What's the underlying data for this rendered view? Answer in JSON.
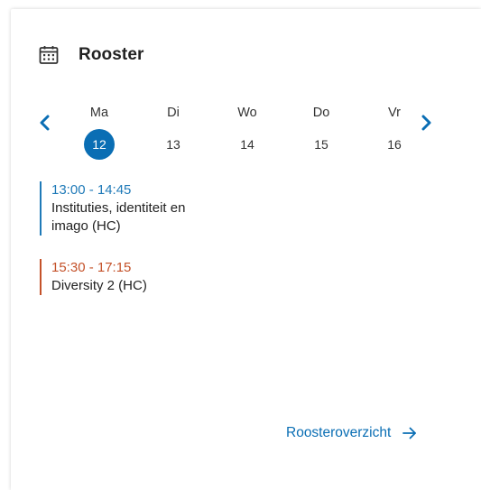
{
  "widget": {
    "title": "Rooster",
    "icon": "calendar-icon"
  },
  "colors": {
    "accent": "#0a6eb4",
    "event_blue": "#1f7ab8",
    "event_orange": "#c4522a"
  },
  "week": {
    "prev_icon": "chevron-left-icon",
    "next_icon": "chevron-right-icon",
    "days": [
      {
        "name": "Ma",
        "number": "12",
        "selected": true
      },
      {
        "name": "Di",
        "number": "13",
        "selected": false
      },
      {
        "name": "Wo",
        "number": "14",
        "selected": false
      },
      {
        "name": "Do",
        "number": "15",
        "selected": false
      },
      {
        "name": "Vr",
        "number": "16",
        "selected": false
      }
    ]
  },
  "events": [
    {
      "time": "13:00 - 14:45",
      "title": "Instituties, identiteit en imago (HC)",
      "color": "#1f7ab8"
    },
    {
      "time": "15:30 - 17:15",
      "title": "Diversity 2 (HC)",
      "color": "#c4522a"
    }
  ],
  "footer": {
    "link_label": "Roosteroverzicht",
    "link_icon": "arrow-right-icon"
  }
}
